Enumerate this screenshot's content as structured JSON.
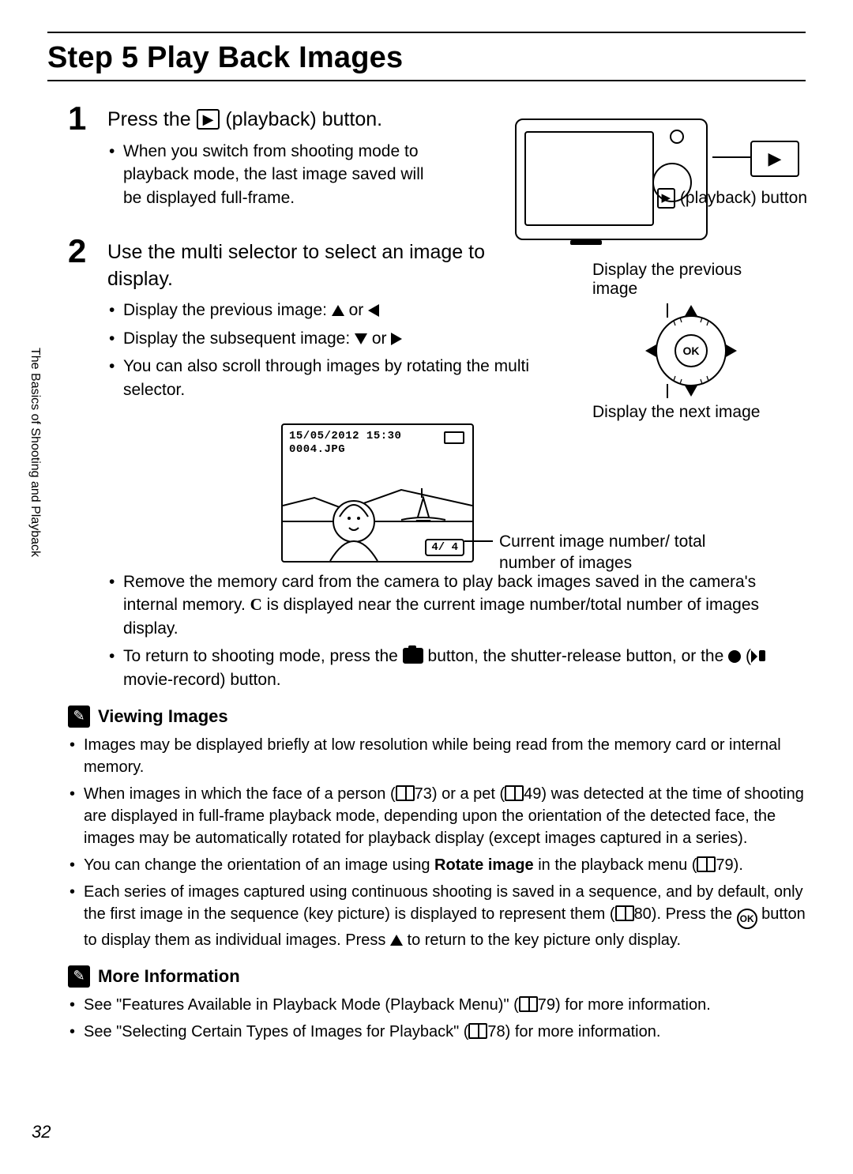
{
  "title": "Step 5 Play Back Images",
  "sidebar": "The Basics of Shooting and Playback",
  "page_number": "32",
  "step1": {
    "num": "1",
    "head_pre": "Press the ",
    "head_post": " (playback) button.",
    "bullet1": "When you switch from shooting mode to playback mode, the last image saved will be displayed full-frame.",
    "fig_play_glyph": "▶",
    "fig_label": "(playback) button"
  },
  "step2": {
    "num": "2",
    "head": "Use the multi selector to select an image to display.",
    "b1_pre": "Display the previous image: ",
    "b1_mid": " or ",
    "b2_pre": "Display the subsequent image: ",
    "b2_mid": " or ",
    "b3": "You can also scroll through images by rotating the multi selector.",
    "sel_top": "Display the previous image",
    "sel_bot": "Display the next image",
    "ok": "OK"
  },
  "lcd": {
    "date": "15/05/2012 15:30",
    "file": "0004.JPG",
    "count": "4/    4",
    "caption": "Current image number/ total number of images"
  },
  "after": {
    "b4a": "Remove the memory card from the camera to play back images saved in the camera's internal memory. ",
    "b4b": " is displayed near the current image number/total number of images display.",
    "intmem": "C",
    "b5a": "To return to shooting mode, press the ",
    "b5b": " button, the shutter-release button, or the ",
    "b5c": " movie-record) button.",
    "open_paren": " ("
  },
  "viewing": {
    "title": "Viewing Images",
    "n1": "Images may be displayed briefly at low resolution while being read from the memory card or internal memory.",
    "n2a": "When images in which the face of a person (",
    "n2b": "73) or a pet (",
    "n2c": "49) was detected at the time of shooting are displayed in full-frame playback mode, depending upon the orientation of the detected face, the images may be automatically rotated for playback display (except images captured in a series).",
    "n3a": "You can change the orientation of an image using ",
    "n3bold": "Rotate image",
    "n3b": " in the playback menu (",
    "n3c": "79).",
    "n4a": "Each series of images captured using continuous shooting is saved in a sequence, and by default, only the first image in the sequence (key picture) is displayed to represent them (",
    "n4b": "80). Press the ",
    "n4c": " button to display them as individual images. Press ",
    "n4d": " to return to the key picture only display."
  },
  "more": {
    "title": "More Information",
    "m1a": "See \"Features Available in Playback Mode (Playback Menu)\" (",
    "m1b": "79) for more information.",
    "m2a": "See \"Selecting Certain Types of Images for Playback\" (",
    "m2b": "78) for more information."
  }
}
